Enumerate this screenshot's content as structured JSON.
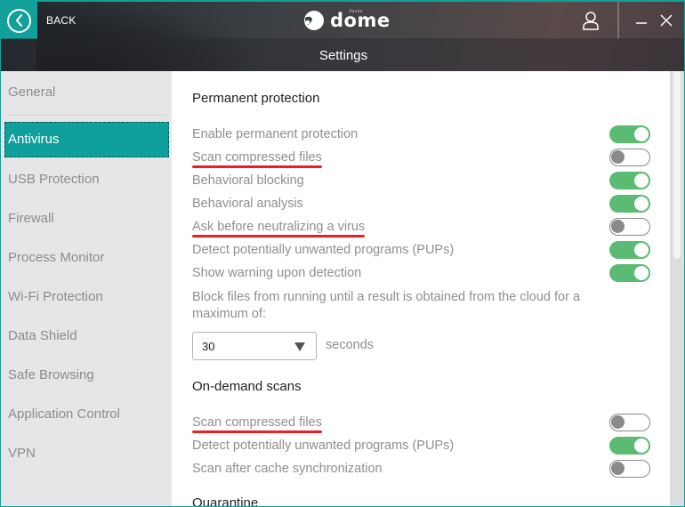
{
  "header": {
    "back_label": "BACK",
    "logo_text": "dome",
    "logo_small": "Panda",
    "page_title": "Settings",
    "icons": {
      "back": "chevron-left-icon",
      "user": "user-icon",
      "minimize": "minimize-icon",
      "close": "close-icon"
    }
  },
  "sidebar": {
    "items": [
      {
        "label": "General",
        "active": false
      },
      {
        "label": "Antivirus",
        "active": true
      },
      {
        "label": "USB Protection",
        "active": false
      },
      {
        "label": "Firewall",
        "active": false
      },
      {
        "label": "Process Monitor",
        "active": false
      },
      {
        "label": "Wi-Fi Protection",
        "active": false
      },
      {
        "label": "Data Shield",
        "active": false
      },
      {
        "label": "Safe Browsing",
        "active": false
      },
      {
        "label": "Application Control",
        "active": false
      },
      {
        "label": "VPN",
        "active": false
      }
    ]
  },
  "content": {
    "permanent": {
      "title": "Permanent protection",
      "options": [
        {
          "label": "Enable permanent protection",
          "enabled": true,
          "highlighted": false
        },
        {
          "label": "Scan compressed files",
          "enabled": false,
          "highlighted": true
        },
        {
          "label": "Behavioral blocking",
          "enabled": true,
          "highlighted": false
        },
        {
          "label": "Behavioral analysis",
          "enabled": true,
          "highlighted": false
        },
        {
          "label": "Ask before neutralizing a virus",
          "enabled": false,
          "highlighted": true
        },
        {
          "label": "Detect potentially unwanted programs (PUPs)",
          "enabled": true,
          "highlighted": false
        },
        {
          "label": "Show warning upon detection",
          "enabled": true,
          "highlighted": false
        }
      ],
      "block_text": "Block files from running until a result is obtained from the cloud for a maximum of:",
      "block_select_value": "30",
      "block_unit": "seconds"
    },
    "ondemand": {
      "title": "On-demand scans",
      "options": [
        {
          "label": "Scan compressed files",
          "enabled": false,
          "highlighted": true
        },
        {
          "label": "Detect potentially unwanted programs (PUPs)",
          "enabled": true,
          "highlighted": false
        },
        {
          "label": "Scan after cache synchronization",
          "enabled": false,
          "highlighted": false
        }
      ]
    },
    "quarantine": {
      "title": "Quarantine"
    }
  },
  "colors": {
    "accent": "#0fa09c",
    "toggle_on": "#5bbb72",
    "toggle_off": "#8a8a8a",
    "highlight_underline": "#e8202a"
  }
}
